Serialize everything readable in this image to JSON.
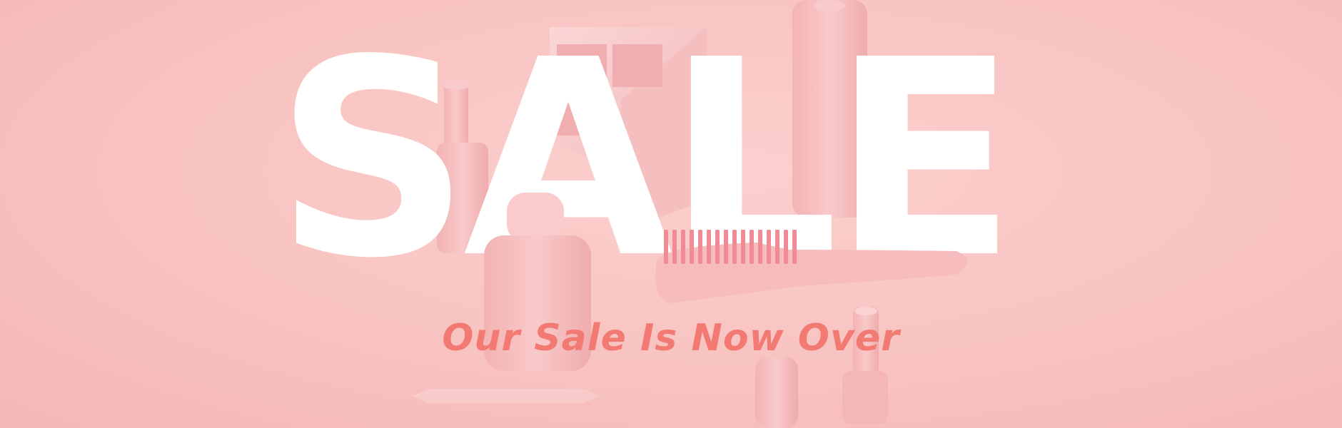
{
  "banner": {
    "headline": "SALE",
    "subtitle": "Our Sale Is Now Over"
  },
  "colors": {
    "background": "#f8c4c2",
    "headline": "#ffffff",
    "subtitle": "#f27a72",
    "product": "#f6bcbc"
  },
  "products": [
    "pump-bottle",
    "eyeshadow-palette",
    "tall-bottle",
    "perfume-bottle",
    "hair-brush",
    "eyeliner-pencil",
    "lip-gloss-tube",
    "lipstick"
  ]
}
